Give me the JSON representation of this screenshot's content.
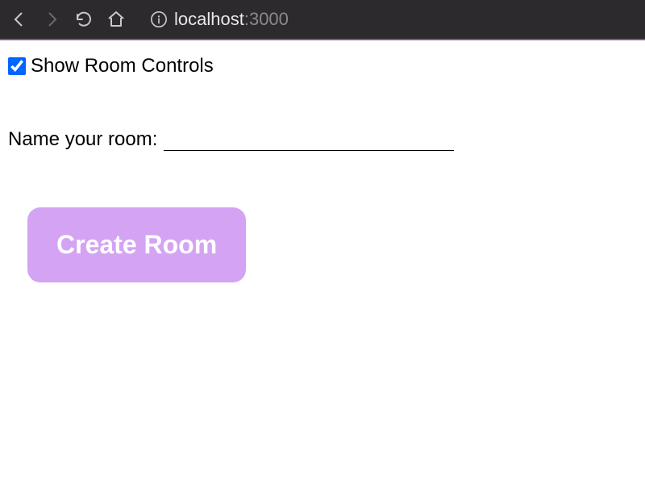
{
  "browser": {
    "url_host": "localhost",
    "url_port": ":3000"
  },
  "page": {
    "checkbox_label": "Show Room Controls",
    "checkbox_checked": true,
    "form_label": "Name your room:",
    "room_name_value": "",
    "create_button_label": "Create Room"
  }
}
